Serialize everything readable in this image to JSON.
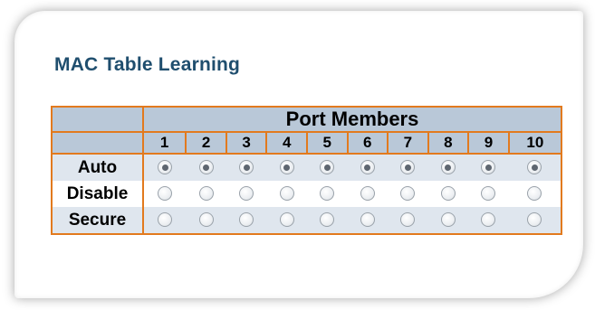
{
  "title": "MAC Table Learning",
  "header": {
    "group_label": "Port Members"
  },
  "ports": [
    "1",
    "2",
    "3",
    "4",
    "5",
    "6",
    "7",
    "8",
    "9",
    "10"
  ],
  "rows": [
    {
      "label": "Auto",
      "selected": [
        true,
        true,
        true,
        true,
        true,
        true,
        true,
        true,
        true,
        true
      ]
    },
    {
      "label": "Disable",
      "selected": [
        false,
        false,
        false,
        false,
        false,
        false,
        false,
        false,
        false,
        false
      ]
    },
    {
      "label": "Secure",
      "selected": [
        false,
        false,
        false,
        false,
        false,
        false,
        false,
        false,
        false,
        false
      ]
    }
  ]
}
